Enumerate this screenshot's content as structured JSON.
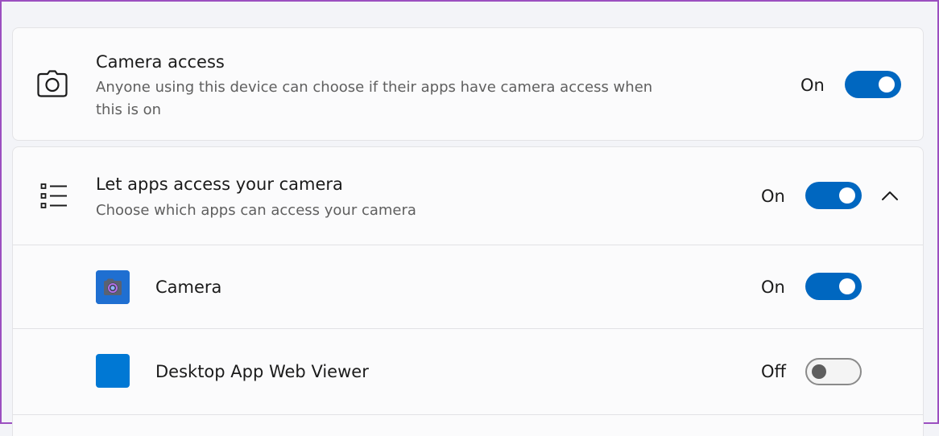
{
  "camera_access": {
    "title": "Camera access",
    "description": "Anyone using this device can choose if their apps have camera access when this is on",
    "icon": "camera-icon",
    "state_label": "On",
    "enabled": true
  },
  "let_apps_access": {
    "title": "Let apps access your camera",
    "description": "Choose which apps can access your camera",
    "icon": "list-icon",
    "state_label": "On",
    "enabled": true,
    "expanded": true,
    "expand_icon": "chevron-up-icon"
  },
  "apps": [
    {
      "name": "Camera",
      "icon": "camera-app-icon",
      "state_label": "On",
      "enabled": true
    },
    {
      "name": "Desktop App Web Viewer",
      "icon": "desktop-app-web-viewer-icon",
      "state_label": "Off",
      "enabled": false
    }
  ],
  "colors": {
    "accent": "#0067c0",
    "app_tile": "#0078d4"
  }
}
